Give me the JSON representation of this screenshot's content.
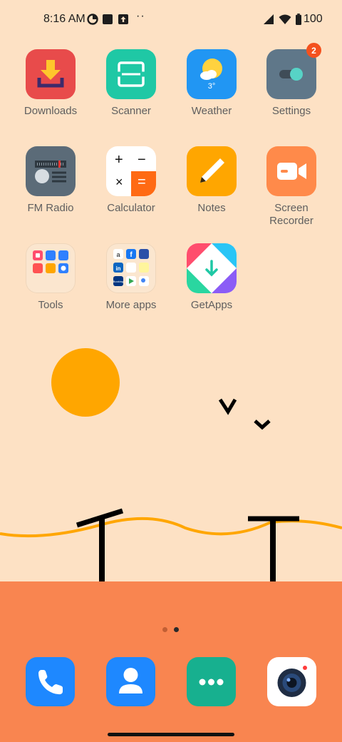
{
  "status_bar": {
    "time": "8:16 AM",
    "left_icons": [
      "data-saver-icon",
      "square-notification-icon",
      "upload-icon"
    ],
    "more": "··",
    "right_icons": [
      "signal-icon",
      "wifi-icon",
      "battery-icon"
    ],
    "battery_percent": "100"
  },
  "apps": [
    {
      "label": "Downloads",
      "icon": "download-icon",
      "color": "#e84b4b"
    },
    {
      "label": "Scanner",
      "icon": "scanner-icon",
      "color": "#1fc8a5"
    },
    {
      "label": "Weather",
      "icon": "weather-icon",
      "color": "#2196f3",
      "temperature": "3°"
    },
    {
      "label": "Settings",
      "icon": "settings-toggle-icon",
      "color": "#5f7789",
      "badge": "2"
    },
    {
      "label": "FM Radio",
      "icon": "radio-icon",
      "color": "#5b6b78"
    },
    {
      "label": "Calculator",
      "icon": "calculator-icon",
      "color": "#ffffff"
    },
    {
      "label": "Notes",
      "icon": "pencil-icon",
      "color": "#ffa600"
    },
    {
      "label": "Screen Recorder",
      "icon": "video-camera-icon",
      "color": "#ff8a4a"
    },
    {
      "label": "Tools",
      "icon": "folder-icon",
      "color": "#fbe6cf"
    },
    {
      "label": "More apps",
      "icon": "folder-icon",
      "color": "#fbe6cf"
    },
    {
      "label": "GetApps",
      "icon": "getapps-icon",
      "color": "#2ad6a0"
    }
  ],
  "calculator_symbols": [
    "+",
    "−",
    "×",
    "="
  ],
  "more_apps_folder_labels": [
    "a",
    "f",
    "in",
    "Booking"
  ],
  "dock": [
    {
      "name": "phone",
      "icon": "phone-icon",
      "color": "#1e88ff"
    },
    {
      "name": "contacts",
      "icon": "person-icon",
      "color": "#1e88ff"
    },
    {
      "name": "messages",
      "icon": "message-dots-icon",
      "color": "#17b08f"
    },
    {
      "name": "camera",
      "icon": "camera-icon",
      "color": "#ffffff"
    }
  ],
  "page_indicator": {
    "total": 2,
    "current": 2
  },
  "colors": {
    "wallpaper": "#fde1c4",
    "ground": "#f98550",
    "sun": "#ffa600",
    "wire": "#ffa600"
  }
}
